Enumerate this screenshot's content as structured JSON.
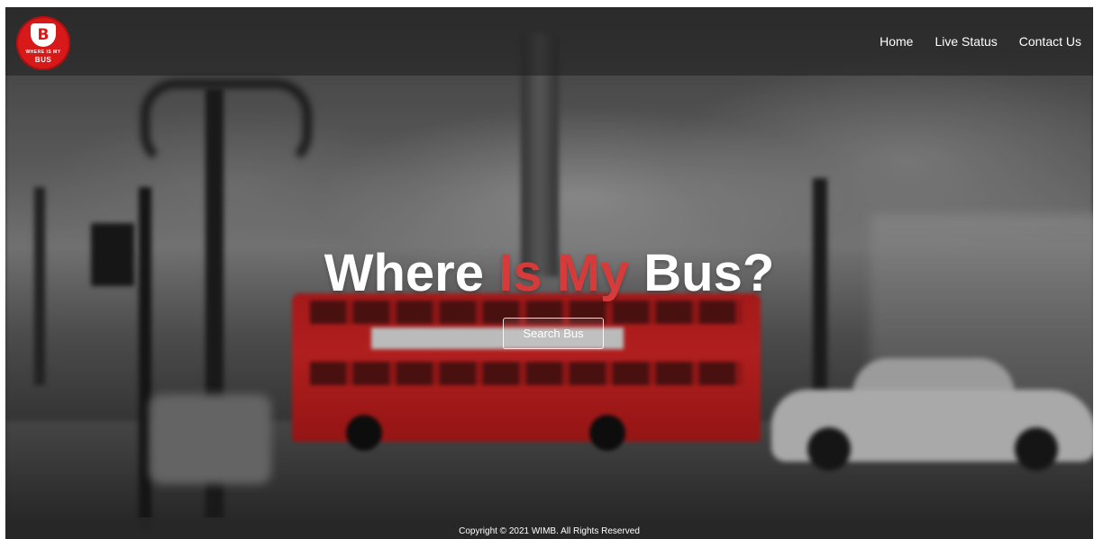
{
  "brand": {
    "logo_letter": "B",
    "logo_tagline": "WHERE IS MY",
    "logo_word": "BUS",
    "color": "#d81919"
  },
  "nav": {
    "items": [
      {
        "label": "Home"
      },
      {
        "label": "Live Status"
      },
      {
        "label": "Contact Us"
      }
    ]
  },
  "hero": {
    "title_part1": "Where ",
    "title_accent": "Is My",
    "title_part2": " Bus?",
    "accent_color": "#d63b3b",
    "button_label": "Search Bus"
  },
  "footer": {
    "copyright": "Copyright © 2021 WIMB. All Rights Reserved"
  }
}
